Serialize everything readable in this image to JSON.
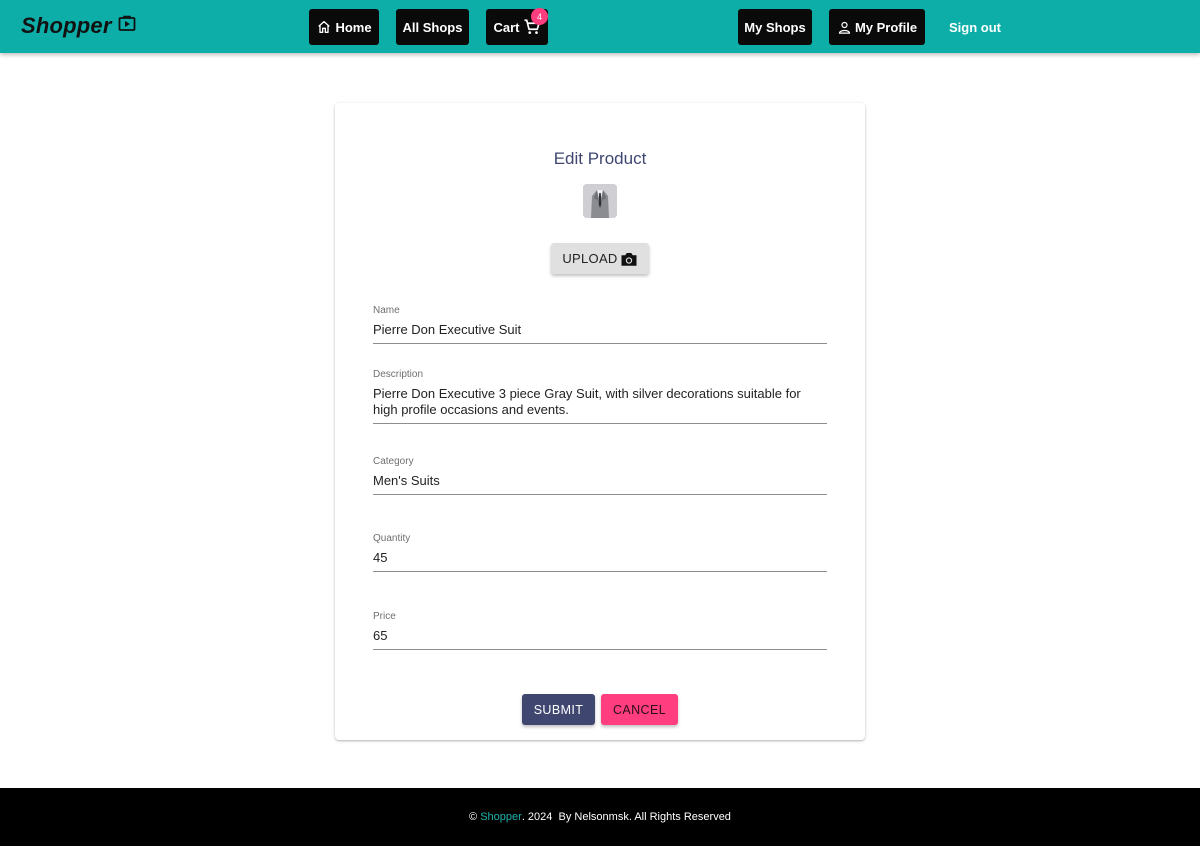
{
  "header": {
    "brand": "Shopper",
    "brand_color": "#0eaea8",
    "nav": {
      "home": "Home",
      "all_shops": "All Shops",
      "cart": "Cart",
      "cart_count": "4",
      "my_shops": "My Shops",
      "my_profile": "My Profile",
      "sign_out": "Sign out"
    }
  },
  "form": {
    "title": "Edit Product",
    "upload_label": "UPLOAD",
    "fields": {
      "name": {
        "label": "Name",
        "value": "Pierre Don Executive Suit"
      },
      "description": {
        "label": "Description",
        "value": "Pierre Don Executive 3 piece Gray Suit, with silver decorations suitable for high profile occasions and events."
      },
      "category": {
        "label": "Category",
        "value": "Men's Suits"
      },
      "quantity": {
        "label": "Quantity",
        "value": "45"
      },
      "price": {
        "label": "Price",
        "value": "65"
      }
    },
    "submit_label": "SUBMIT",
    "cancel_label": "CANCEL",
    "colors": {
      "submit": "#3f4771",
      "cancel": "#ff3d7f"
    }
  },
  "footer": {
    "copyright": "©",
    "brand": "Shopper",
    "year_text": ". 2024",
    "author_text": "By Nelsonmsk. All Rights Reserved"
  },
  "icons": {
    "brand": "play-bag-icon",
    "home": "home-icon",
    "cart": "cart-icon",
    "profile": "person-icon",
    "upload": "camera-icon"
  }
}
